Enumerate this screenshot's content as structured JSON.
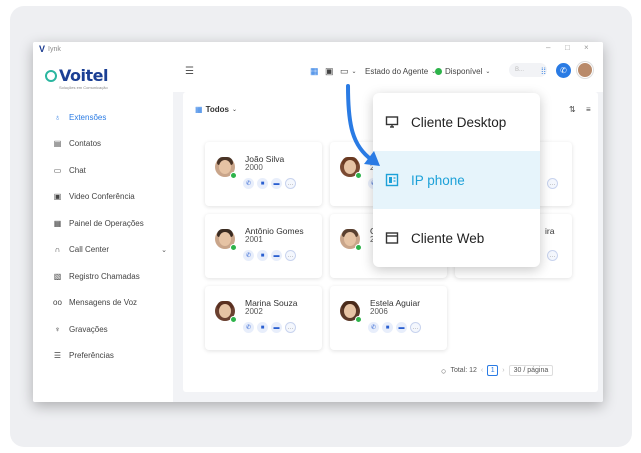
{
  "window": {
    "title": "Iynk",
    "controls": [
      "–",
      "□",
      "×"
    ]
  },
  "brand": {
    "name": "Voitel",
    "tagline": "Soluções em Comunicação"
  },
  "sidebar": {
    "items": [
      {
        "label": "Extensões",
        "icon": "extensions-icon",
        "active": true
      },
      {
        "label": "Contatos",
        "icon": "contacts-icon"
      },
      {
        "label": "Chat",
        "icon": "chat-icon"
      },
      {
        "label": "Video Conferência",
        "icon": "video-conference-icon"
      },
      {
        "label": "Painel de Operações",
        "icon": "operations-panel-icon"
      },
      {
        "label": "Call Center",
        "icon": "headset-icon",
        "expandable": true
      },
      {
        "label": "Registro Chamadas",
        "icon": "call-log-icon"
      },
      {
        "label": "Mensagens de Voz",
        "icon": "voicemail-icon"
      },
      {
        "label": "Gravações",
        "icon": "microphone-icon"
      },
      {
        "label": "Preferências",
        "icon": "preferences-icon"
      }
    ]
  },
  "topbar": {
    "agent_state": "Estado do Agente",
    "availability": "Disponível",
    "search_placeholder": "B..."
  },
  "filter": {
    "label": "Todos"
  },
  "contacts": [
    {
      "name": "João Silva",
      "ext": "2000"
    },
    {
      "name": "A",
      "ext": "2"
    },
    {
      "name": "",
      "ext": ""
    },
    {
      "name": "Antônio Gomes",
      "ext": "2001"
    },
    {
      "name": "C",
      "ext": "2"
    },
    {
      "name": "ira",
      "ext": ""
    },
    {
      "name": "Marina Souza",
      "ext": "2002"
    },
    {
      "name": "Estela Aguiar",
      "ext": "2006"
    }
  ],
  "dropdown": {
    "items": [
      {
        "label": "Cliente Desktop",
        "icon": "desktop-icon",
        "selected": false
      },
      {
        "label": "IP phone",
        "icon": "ip-phone-icon",
        "selected": true
      },
      {
        "label": "Cliente Web",
        "icon": "web-client-icon",
        "selected": false
      }
    ]
  },
  "pager": {
    "total": "Total: 12",
    "page": "1",
    "size": "30 / página"
  },
  "colors": {
    "accent": "#2a7be4",
    "brand": "#1b3f94",
    "selected_bg": "#e6f4fb",
    "selected_text": "#1da1d8",
    "online": "#2db34a"
  }
}
